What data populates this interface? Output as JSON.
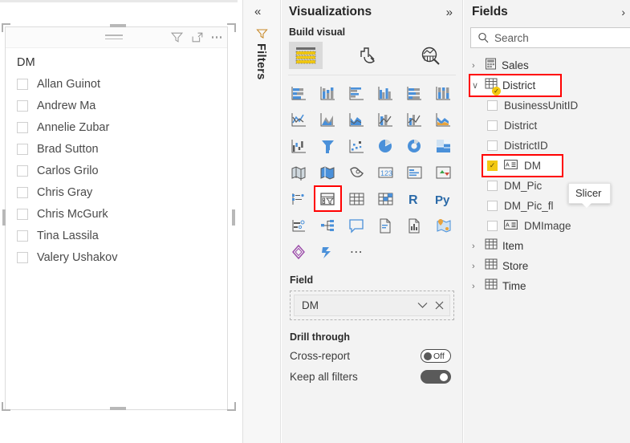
{
  "canvas": {
    "slicer": {
      "title": "DM",
      "header_icons": [
        "hamburger-menu-icon",
        "filter-icon",
        "focus-mode-icon",
        "more-options-icon"
      ],
      "items": [
        {
          "label": "Allan Guinot",
          "checked": false
        },
        {
          "label": "Andrew Ma",
          "checked": false
        },
        {
          "label": "Annelie Zubar",
          "checked": false
        },
        {
          "label": "Brad Sutton",
          "checked": false
        },
        {
          "label": "Carlos Grilo",
          "checked": false
        },
        {
          "label": "Chris Gray",
          "checked": false
        },
        {
          "label": "Chris McGurk",
          "checked": false
        },
        {
          "label": "Tina Lassila",
          "checked": false
        },
        {
          "label": "Valery Ushakov",
          "checked": false
        }
      ]
    }
  },
  "filters_rail": {
    "collapse_label": "«",
    "title": "Filters"
  },
  "visualizations": {
    "title": "Visualizations",
    "expand_label": "»",
    "build_visual_label": "Build visual",
    "tabs": [
      {
        "name": "build-visual-tab",
        "selected": true
      },
      {
        "name": "format-visual-tab",
        "selected": false
      },
      {
        "name": "analytics-tab",
        "selected": false
      }
    ],
    "tooltip": "Slicer",
    "selected_visual": "slicer",
    "gallery": [
      "stacked-bar-chart",
      "stacked-column-chart",
      "clustered-bar-chart",
      "clustered-column-chart",
      "100-stacked-bar-chart",
      "100-stacked-column-chart",
      "line-chart",
      "area-chart",
      "stacked-area-chart",
      "line-and-stacked-column-chart",
      "line-and-clustered-column-chart",
      "ribbon-chart",
      "waterfall-chart",
      "funnel-chart",
      "scatter-chart",
      "pie-chart",
      "donut-chart",
      "treemap",
      "map",
      "filled-map",
      "shape-map",
      "azure-map",
      "card",
      "multi-row-card",
      "kpi",
      "slicer",
      "table",
      "matrix",
      "r-script-visual",
      "python-visual",
      "key-influencers",
      "decomposition-tree",
      "q-and-a",
      "narrative",
      "paginated-report",
      "arcgis-map",
      "power-apps",
      "power-automate",
      "more-visuals"
    ],
    "field_section": {
      "label": "Field",
      "value": "DM",
      "dropdown_icon": "chevron-down-icon",
      "remove_icon": "close-icon"
    },
    "drill_through": {
      "label": "Drill through",
      "rows": [
        {
          "label": "Cross-report",
          "state": "Off",
          "on": false
        },
        {
          "label": "Keep all filters",
          "state": "On",
          "on": true
        }
      ]
    }
  },
  "fields": {
    "title": "Fields",
    "close_label": "›",
    "search": {
      "placeholder": "Search",
      "value": "",
      "icon": "search-icon"
    },
    "tables": [
      {
        "label": "Sales",
        "expanded": false,
        "icon": "measure-table-icon",
        "highlighted": false,
        "badge": false
      },
      {
        "label": "District",
        "expanded": true,
        "icon": "table-icon",
        "highlighted": true,
        "badge": true
      },
      {
        "label": "Item",
        "expanded": false,
        "icon": "table-icon",
        "highlighted": false,
        "badge": false
      },
      {
        "label": "Store",
        "expanded": false,
        "icon": "table-icon",
        "highlighted": false,
        "badge": false
      },
      {
        "label": "Time",
        "expanded": false,
        "icon": "table-icon",
        "highlighted": false,
        "badge": false
      }
    ],
    "district_fields": [
      {
        "label": "BusinessUnitID",
        "checked": false,
        "type_icon": false,
        "highlighted": false
      },
      {
        "label": "District",
        "checked": false,
        "type_icon": false,
        "highlighted": false
      },
      {
        "label": "DistrictID",
        "checked": false,
        "type_icon": false,
        "highlighted": false
      },
      {
        "label": "DM",
        "checked": true,
        "type_icon": true,
        "highlighted": true
      },
      {
        "label": "DM_Pic",
        "checked": false,
        "type_icon": false,
        "highlighted": false
      },
      {
        "label": "DM_Pic_fl",
        "checked": false,
        "type_icon": false,
        "highlighted": false
      },
      {
        "label": "DMImage",
        "checked": false,
        "type_icon": true,
        "highlighted": false
      }
    ]
  },
  "colors": {
    "highlight_red": "#FF0000",
    "powerbi_yellow": "#F2C811",
    "panel_bg": "#F3F3F3",
    "accent_blue": "#4A90D9"
  }
}
